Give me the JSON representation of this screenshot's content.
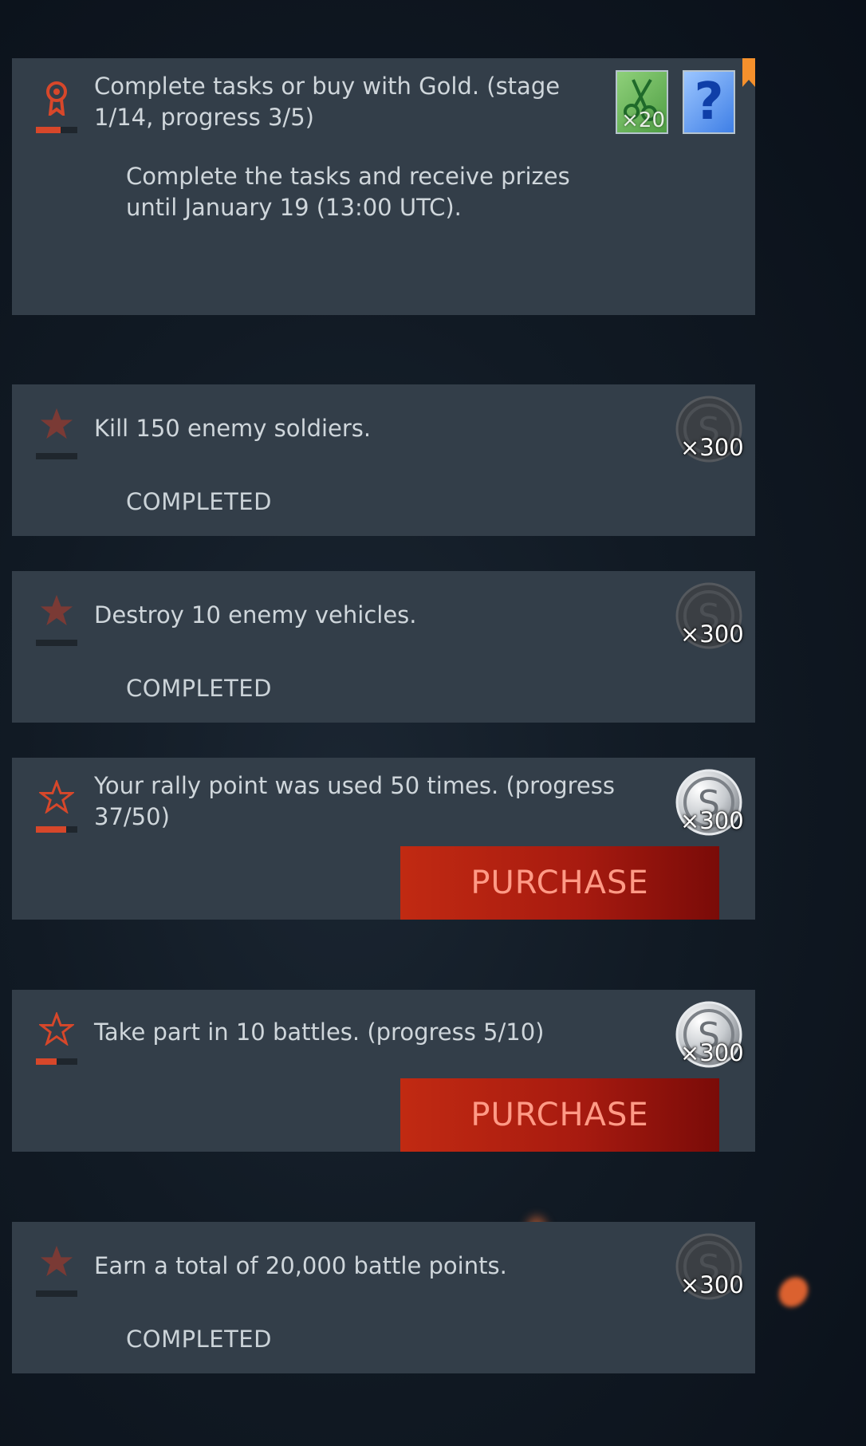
{
  "header_task": {
    "title": "Complete tasks or buy with Gold. (stage 1/14, progress 3/5)",
    "description": "Complete the tasks and receive prizes until January 19 (13:00 UTC).",
    "progress": 0.6,
    "rewards": [
      {
        "icon": "scissors-item-icon",
        "qty": "×20"
      },
      {
        "icon": "question-mark-icon"
      }
    ]
  },
  "tasks": [
    {
      "title": "Kill 150 enemy soldiers.",
      "state": "COMPLETED",
      "reward_qty": "×300",
      "icon": "filled-star-icon",
      "progress": 1.0
    },
    {
      "title": "Destroy 10 enemy vehicles.",
      "state": "COMPLETED",
      "reward_qty": "×300",
      "icon": "filled-star-icon",
      "progress": 1.0
    },
    {
      "title": "Your rally point was used 50 times. (progress 37/50)",
      "button": "PURCHASE",
      "reward_qty": "×300",
      "icon": "outline-star-icon",
      "progress": 0.74
    },
    {
      "title": "Take part in 10 battles. (progress 5/10)",
      "button": "PURCHASE",
      "reward_qty": "×300",
      "icon": "outline-star-icon",
      "progress": 0.5
    },
    {
      "title": "Earn a total of 20,000 battle points.",
      "state": "COMPLETED",
      "reward_qty": "×300",
      "icon": "filled-star-icon",
      "progress": 1.0
    }
  ],
  "colors": {
    "card_bg": "#333e49",
    "accent_red": "#d7472a",
    "purchase_gradient_start": "#c12a12",
    "purchase_gradient_end": "#7a0b08",
    "purchase_text": "#ff9a86",
    "bookmark_orange": "#f5902c"
  }
}
